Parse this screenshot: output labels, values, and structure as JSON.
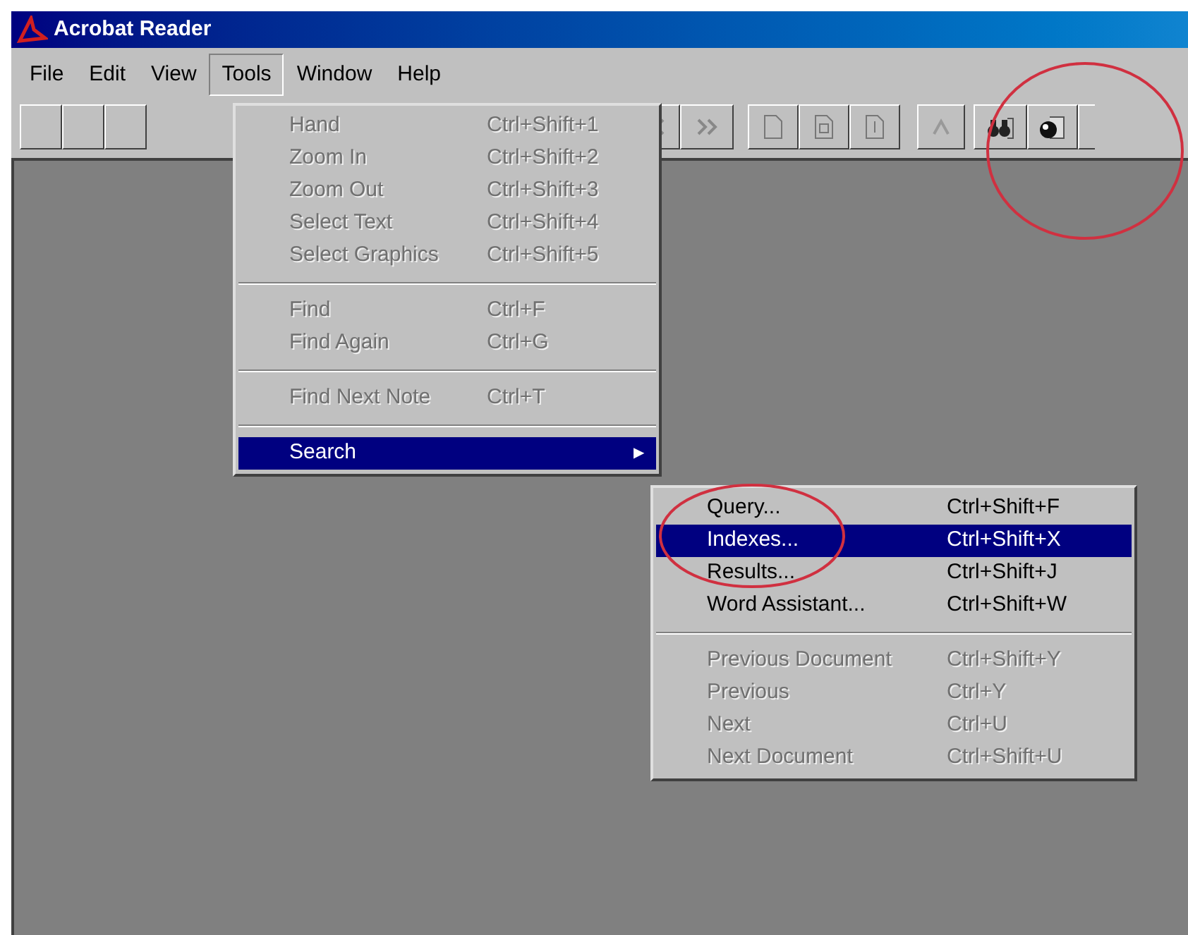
{
  "window": {
    "title": "Acrobat Reader"
  },
  "menu_bar": [
    {
      "label": "File",
      "selected": false
    },
    {
      "label": "Edit",
      "selected": false
    },
    {
      "label": "View",
      "selected": false
    },
    {
      "label": "Tools",
      "selected": true
    },
    {
      "label": "Window",
      "selected": false
    },
    {
      "label": "Help",
      "selected": false
    }
  ],
  "tools_menu": [
    {
      "kind": "item",
      "label": "Hand",
      "shortcut": "Ctrl+Shift+1",
      "disabled": true,
      "selected": false
    },
    {
      "kind": "item",
      "label": "Zoom In",
      "shortcut": "Ctrl+Shift+2",
      "disabled": true,
      "selected": false
    },
    {
      "kind": "item",
      "label": "Zoom Out",
      "shortcut": "Ctrl+Shift+3",
      "disabled": true,
      "selected": false
    },
    {
      "kind": "item",
      "label": "Select Text",
      "shortcut": "Ctrl+Shift+4",
      "disabled": true,
      "selected": false
    },
    {
      "kind": "item",
      "label": "Select Graphics",
      "shortcut": "Ctrl+Shift+5",
      "disabled": true,
      "selected": false
    },
    {
      "kind": "separator"
    },
    {
      "kind": "item",
      "label": "Find",
      "shortcut": "Ctrl+F",
      "disabled": true,
      "selected": false
    },
    {
      "kind": "item",
      "label": "Find Again",
      "shortcut": "Ctrl+G",
      "disabled": true,
      "selected": false
    },
    {
      "kind": "separator"
    },
    {
      "kind": "item",
      "label": "Find Next Note",
      "shortcut": "Ctrl+T",
      "disabled": true,
      "selected": false
    },
    {
      "kind": "separator"
    },
    {
      "kind": "submenu",
      "label": "Search",
      "arrow": "▶",
      "disabled": false,
      "selected": true
    }
  ],
  "search_submenu": [
    {
      "kind": "item",
      "label": "Query...",
      "shortcut": "Ctrl+Shift+F",
      "disabled": false,
      "selected": false
    },
    {
      "kind": "item",
      "label": "Indexes...",
      "shortcut": "Ctrl+Shift+X",
      "disabled": false,
      "selected": true
    },
    {
      "kind": "item",
      "label": "Results...",
      "shortcut": "Ctrl+Shift+J",
      "disabled": false,
      "selected": false
    },
    {
      "kind": "item",
      "label": "Word Assistant...",
      "shortcut": "Ctrl+Shift+W",
      "disabled": false,
      "selected": false
    },
    {
      "kind": "separator"
    },
    {
      "kind": "item",
      "label": "Previous Document",
      "shortcut": "Ctrl+Shift+Y",
      "disabled": true,
      "selected": false
    },
    {
      "kind": "item",
      "label": "Previous",
      "shortcut": "Ctrl+Y",
      "disabled": true,
      "selected": false
    },
    {
      "kind": "item",
      "label": "Next",
      "shortcut": "Ctrl+U",
      "disabled": true,
      "selected": false
    },
    {
      "kind": "item",
      "label": "Next Document",
      "shortcut": "Ctrl+Shift+U",
      "disabled": true,
      "selected": false
    }
  ]
}
